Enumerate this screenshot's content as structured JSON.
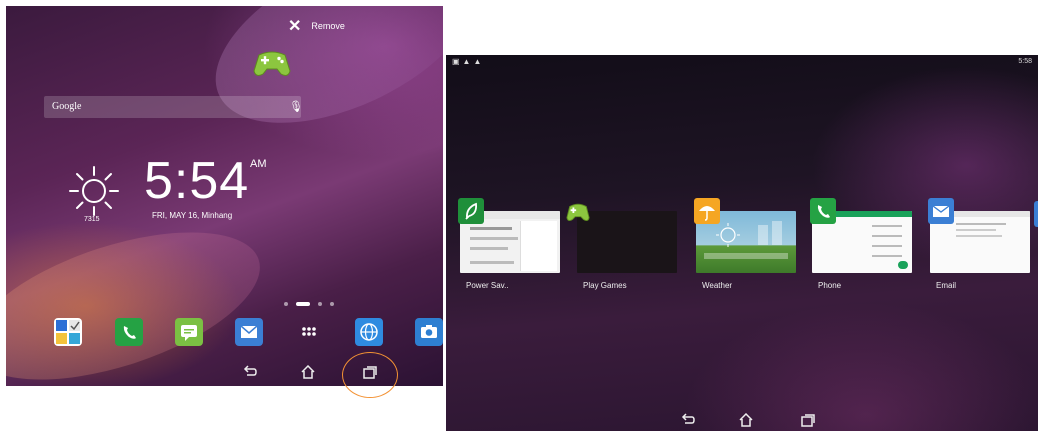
{
  "home": {
    "remove_label": "Remove",
    "search_placeholder": "Google",
    "clock": {
      "time": "5:54",
      "ampm": "AM",
      "date": "FRI, MAY 16, Minhang",
      "temp": "7315"
    },
    "dock_apps": [
      "calendar-icon",
      "phone-icon",
      "messaging-icon",
      "email-icon",
      "all-apps-icon",
      "browser-icon",
      "camera-icon"
    ],
    "page_indicator": {
      "count": 4,
      "active": 1
    }
  },
  "recents": {
    "status_time": "5:58",
    "apps": [
      {
        "label": "Power Sav..",
        "icon": "power-saver-icon",
        "color": "#1f8f3a"
      },
      {
        "label": "Play Games",
        "icon": "play-games-icon",
        "color": "#7ab51d"
      },
      {
        "label": "Weather",
        "icon": "weather-icon",
        "color": "#f5a623"
      },
      {
        "label": "Phone",
        "icon": "phone-icon",
        "color": "#25a244"
      },
      {
        "label": "Email",
        "icon": "email-icon",
        "color": "#3b7fd4"
      }
    ]
  },
  "nav": {
    "back": "back-icon",
    "home": "home-icon",
    "recents": "recents-icon"
  },
  "colors": {
    "highlight": "#f39234"
  }
}
